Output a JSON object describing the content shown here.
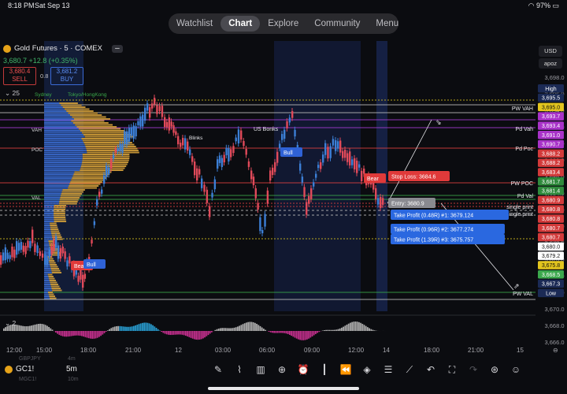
{
  "status": {
    "time": "8:18 PM",
    "date": "Sat Sep 13",
    "battery": "97%"
  },
  "tabs": [
    {
      "label": "Watchlist",
      "active": false
    },
    {
      "label": "Chart",
      "active": true
    },
    {
      "label": "Explore",
      "active": false
    },
    {
      "label": "Community",
      "active": false
    },
    {
      "label": "Menu",
      "active": false
    }
  ],
  "symbol": {
    "name": "Gold Futures · 5 · COMEX",
    "change": "3,680.7 +12.8 (+0.35%)"
  },
  "order": {
    "sell_price": "3,680.4",
    "sell_label": "SELL",
    "spread": "0.8",
    "buy_price": "3,681.2",
    "buy_label": "BUY"
  },
  "indicators": {
    "main_count": "25",
    "osc_count": "2"
  },
  "right_controls": {
    "currency": "USD",
    "mode": "apoz"
  },
  "sessions": {
    "sydney": "Sydney",
    "tokyo": "Tokyo/HongKong"
  },
  "profile_labels": {
    "vah": "VAH",
    "poc": "POC",
    "val": "VAL"
  },
  "chart_labels": {
    "us_open": "US Bonks",
    "bull1": "Bull",
    "bull2": "Bull",
    "bear1": "Bear",
    "bear2": "Bear",
    "sidebar": "Blinks"
  },
  "levels": [
    {
      "name": "PW VAH",
      "price": 3693.8
    },
    {
      "name": "Pd Vah",
      "price": 3688.2
    },
    {
      "name": "Pd Poc",
      "price": 3683.4
    },
    {
      "name": "PW POC",
      "price": 3680.8
    },
    {
      "name": "Pd Val",
      "price": 3680.2
    },
    {
      "name": "single print",
      "price": 3680.7
    },
    {
      "name": "single print",
      "price": 3680.5
    },
    {
      "name": "PW VAL",
      "price": 3668.6
    }
  ],
  "trade": {
    "stop": "Stop Loss: 3684.6",
    "entry": "Entry: 3680.9",
    "tp1": "Take Profit (0.48R) #1: 3679.124",
    "tp2": "Take Profit (0.96R) #2: 3677.274",
    "tp3": "Take Profit (1.39R) #3: 3675.757"
  },
  "price_axis": {
    "ticks": [
      "3,698.0",
      "3,696.0",
      "3,694.0",
      "3,692.0",
      "3,690.0",
      "3,688.0",
      "3,686.0",
      "3,684.0",
      "3,682.0",
      "3,680.0",
      "3,678.0",
      "3,676.0",
      "3,674.0",
      "3,672.0",
      "3,670.0",
      "3,668.0",
      "3,666.0"
    ],
    "badges": [
      {
        "text": "High",
        "color": "#1b2a55"
      },
      {
        "text": "3,695.5",
        "color": "#1b2a55"
      },
      {
        "text": "3,695.0",
        "color": "#e3c51e"
      },
      {
        "text": "3,693.7",
        "color": "#a832c8"
      },
      {
        "text": "3,693.4",
        "color": "#a832c8"
      },
      {
        "text": "3,691.0",
        "color": "#a832c8"
      },
      {
        "text": "3,690.7",
        "color": "#a832c8"
      },
      {
        "text": "3,688.2",
        "color": "#d23a3a"
      },
      {
        "text": "3,688.2",
        "color": "#d23a3a"
      },
      {
        "text": "3,683.4",
        "color": "#d23a3a"
      },
      {
        "text": "3,681.7",
        "color": "#2f8a3c"
      },
      {
        "text": "3,681.4",
        "color": "#2f8a3c"
      },
      {
        "text": "3,680.9",
        "color": "#d23a3a"
      },
      {
        "text": "3,680.8",
        "color": "#d23a3a"
      },
      {
        "text": "3,680.8",
        "color": "#d23a3a"
      },
      {
        "text": "3,680.7",
        "color": "#d23a3a"
      },
      {
        "text": "3,680.7",
        "color": "#d23a3a"
      },
      {
        "text": "3,680.0",
        "color": "#ffffff"
      },
      {
        "text": "3,679.2",
        "color": "#ffffff"
      },
      {
        "text": "3,675.8",
        "color": "#e3c51e"
      },
      {
        "text": "3,668.5",
        "color": "#3ba84c"
      },
      {
        "text": "3,667.3",
        "color": "#1b2a55"
      },
      {
        "text": "Low",
        "color": "#1b2a55"
      }
    ]
  },
  "time_axis": [
    "12:00",
    "15:00",
    "18:00",
    "21:00",
    "12",
    "03:00",
    "06:00",
    "09:00",
    "12:00",
    "14",
    "18:00",
    "21:00",
    "15"
  ],
  "bottom": {
    "ticker": "GC1!",
    "timeframe": "5m",
    "ghost1": "GBPJPY",
    "ghost2": "MGC1!",
    "ghost_tf1": "4m",
    "ghost_tf2": "10m"
  },
  "toolbar": [
    "pen-icon",
    "indicators-icon",
    "templates-icon",
    "add-icon",
    "alert-icon",
    "candle-type-icon",
    "replay-icon",
    "layers-icon",
    "settings-icon",
    "trade-icon",
    "undo-icon",
    "fullscreen-icon",
    "redo-icon",
    "trade-panel-icon",
    "more-icon"
  ],
  "colors": {
    "bull": "#3c7fd6",
    "bear": "#e14a5a",
    "profile_up": "#d4a03a",
    "profile_down": "#3c6fd6"
  }
}
